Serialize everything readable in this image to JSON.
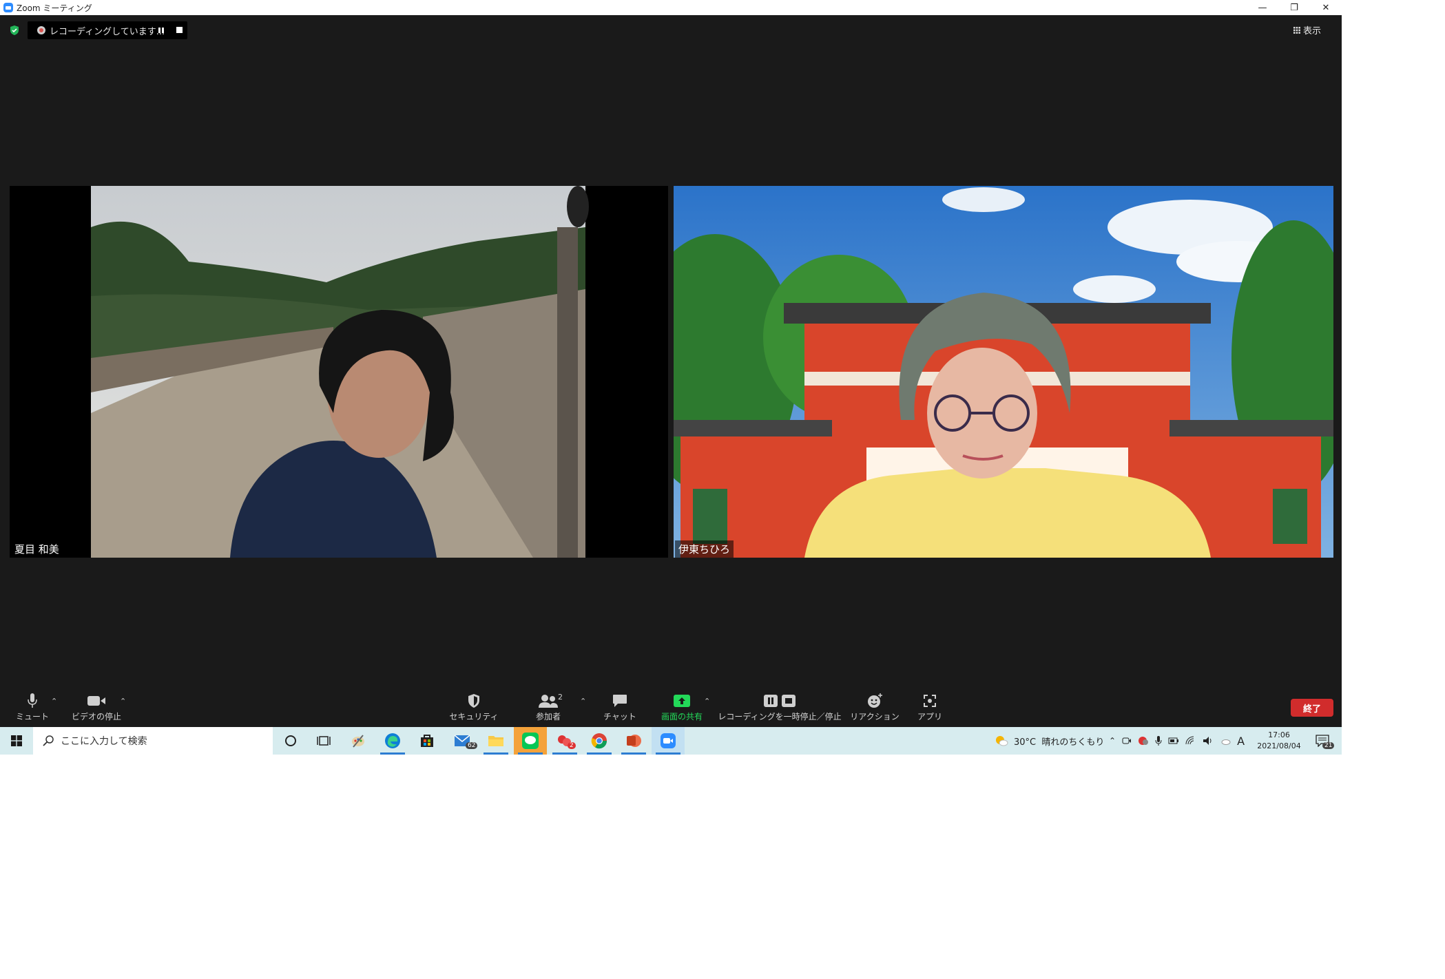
{
  "window": {
    "title": "Zoom ミーティング",
    "controls": [
      "minimize-icon",
      "restore-icon",
      "close-icon"
    ]
  },
  "recording": {
    "status": "レコーディングしています..."
  },
  "view": {
    "label": "表示"
  },
  "participants": [
    {
      "name": "夏目 和美"
    },
    {
      "name": "伊東ちひろ"
    }
  ],
  "toolbar": {
    "mute": "ミュート",
    "video": "ビデオの停止",
    "security": "セキュリティ",
    "participants": "参加者",
    "participants_count": "2",
    "chat": "チャット",
    "share": "画面の共有",
    "recording": "レコーディングを一時停止／停止",
    "reactions": "リアクション",
    "apps": "アプリ",
    "end": "終了"
  },
  "taskbar": {
    "search_placeholder": "ここに入力して検索",
    "mail_badge": "62",
    "red_app_badge": "2",
    "weather": "30°C  晴れのちくもり",
    "ime": "A",
    "time": "17:06",
    "date": "2021/08/04",
    "notifications": "21"
  },
  "colors": {
    "background": "#1a1a1a",
    "share_green": "#23d959",
    "end_red": "#d12c2c",
    "taskbar": "#d7ecef"
  }
}
